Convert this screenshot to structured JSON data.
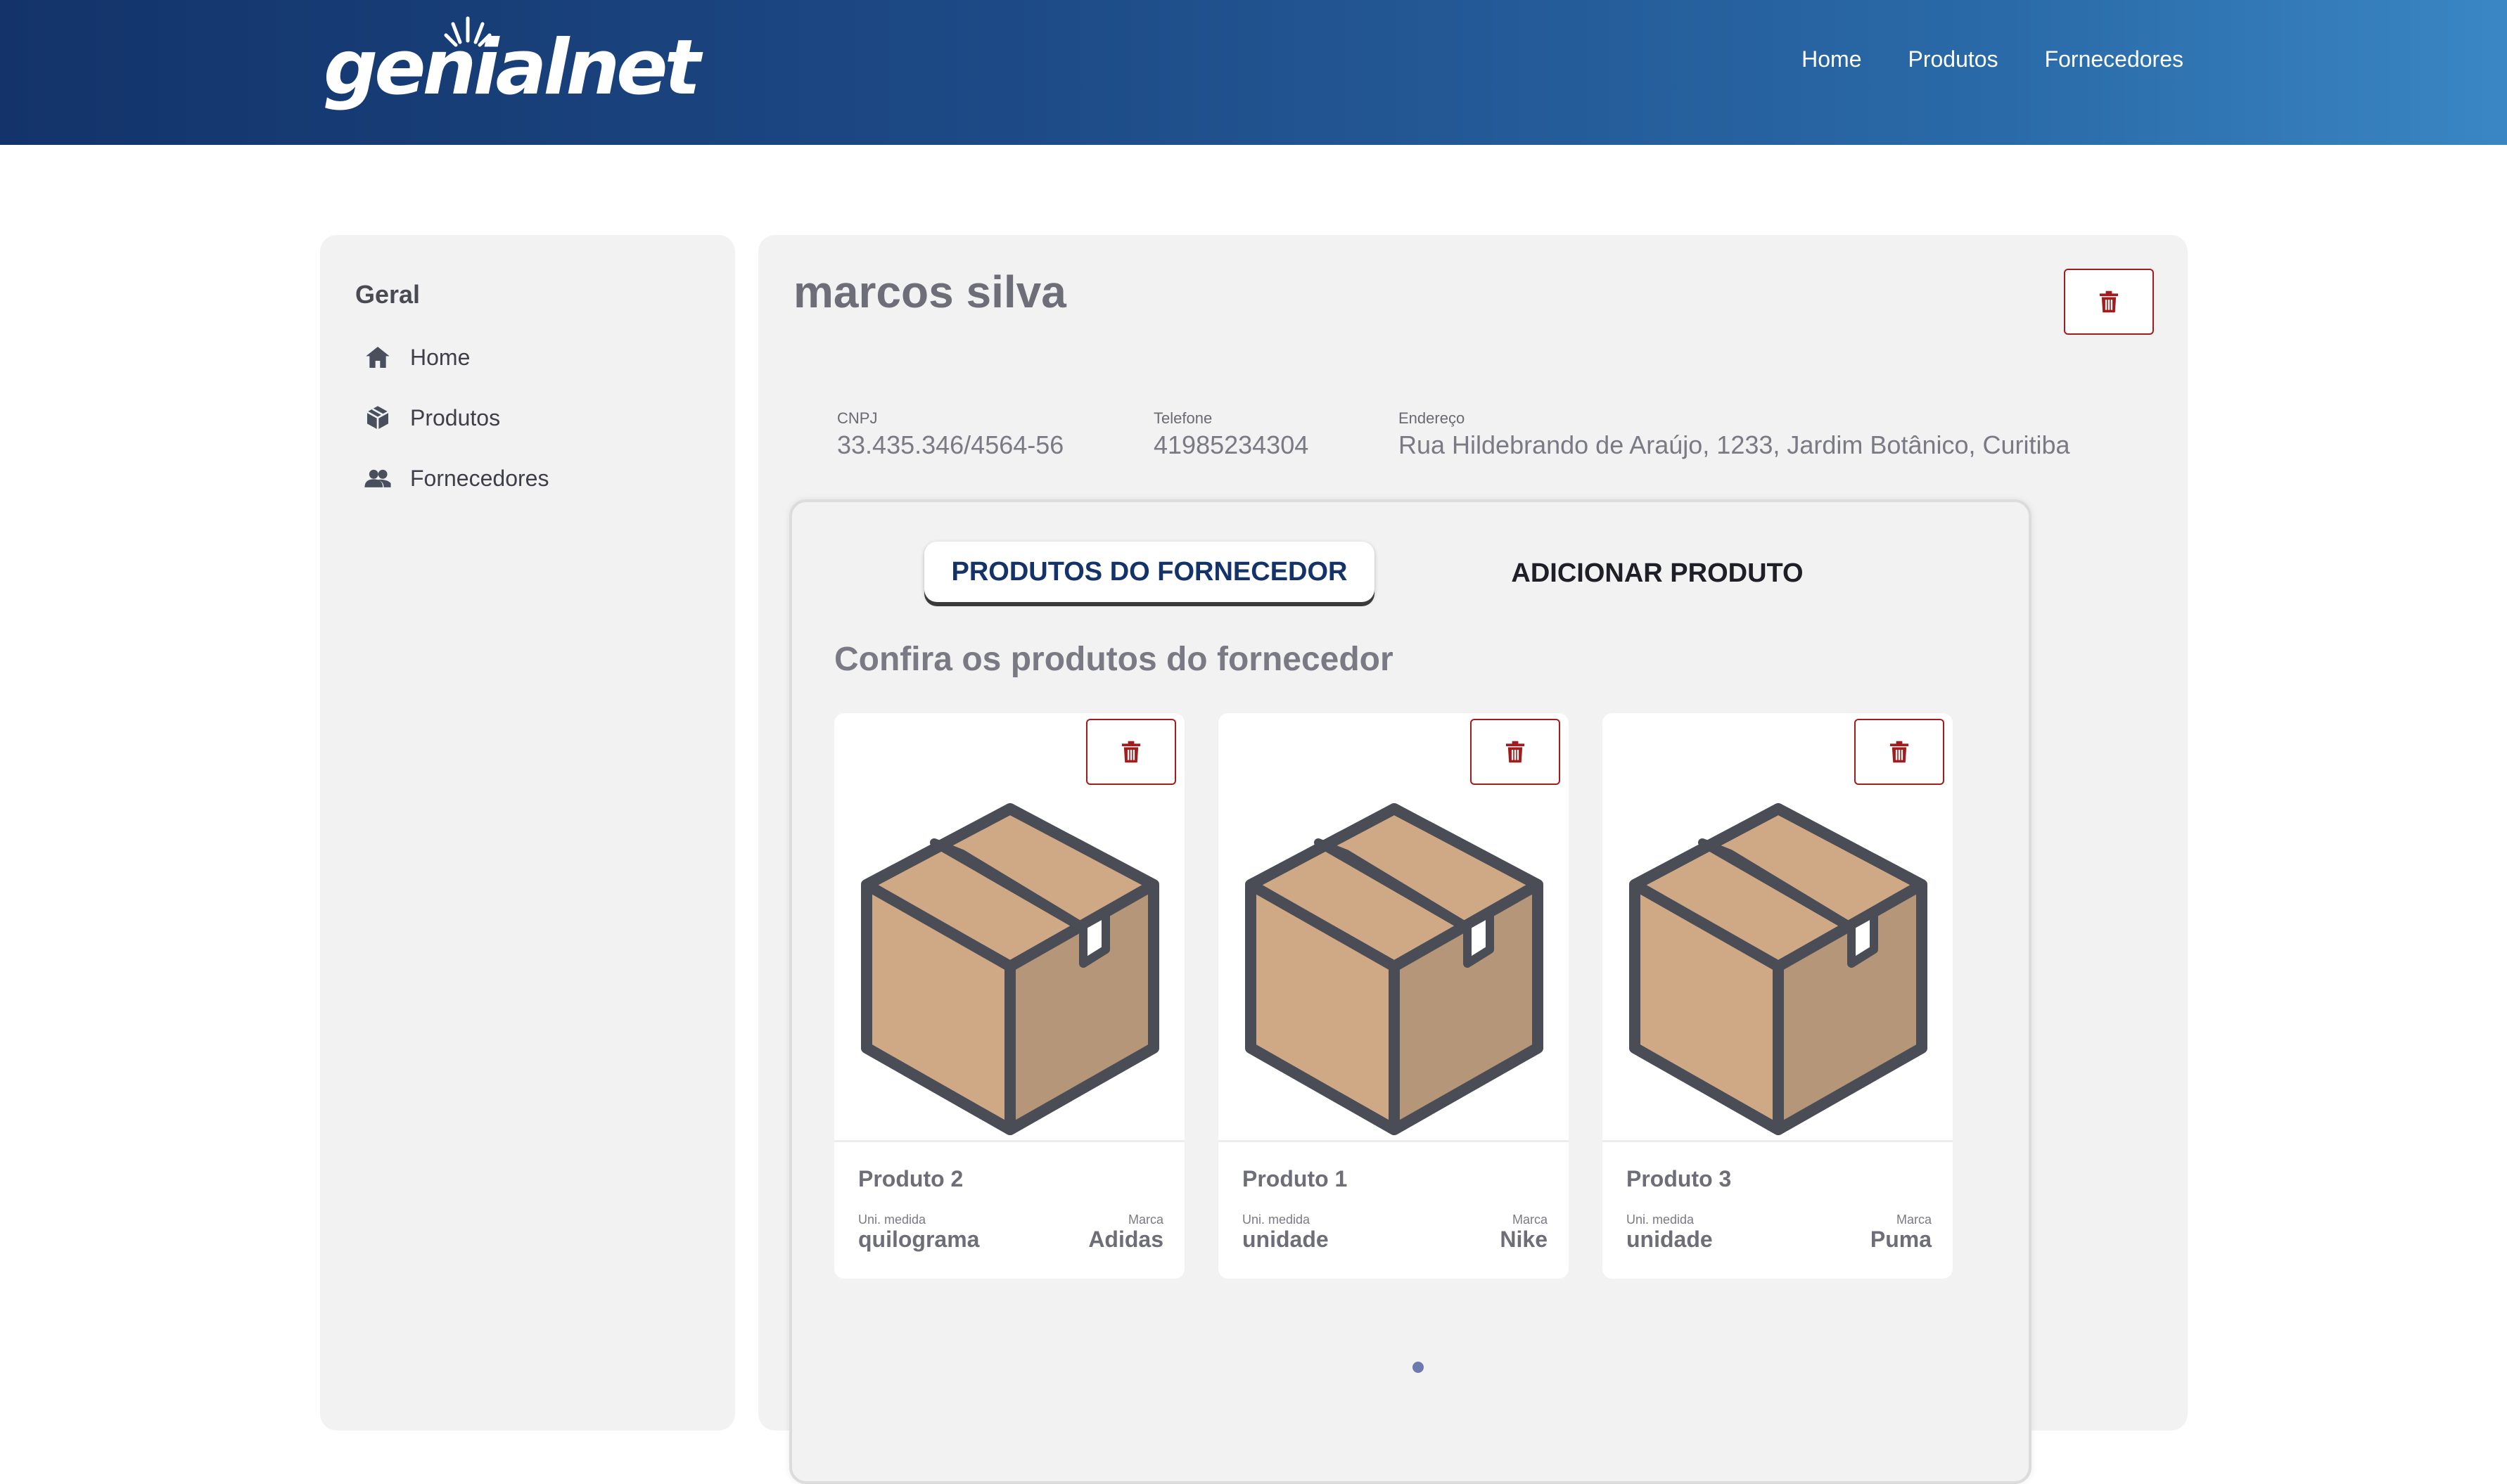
{
  "header": {
    "logo_text": "genialnet",
    "nav": [
      "Home",
      "Produtos",
      "Fornecedores"
    ]
  },
  "sidebar": {
    "title": "Geral",
    "items": [
      {
        "label": "Home",
        "icon": "home-icon"
      },
      {
        "label": "Produtos",
        "icon": "box-icon"
      },
      {
        "label": "Fornecedores",
        "icon": "users-icon"
      }
    ]
  },
  "supplier": {
    "name": "marcos silva",
    "cnpj_label": "CNPJ",
    "cnpj": "33.435.346/4564-56",
    "phone_label": "Telefone",
    "phone": "41985234304",
    "address_label": "Endereço",
    "address": "Rua Hildebrando de Araújo, 1233, Jardim Botânico, Curitiba"
  },
  "tabs": {
    "active": "PRODUTOS DO FORNECEDOR",
    "other": "ADICIONAR PRODUTO"
  },
  "products_section": {
    "title": "Confira os produtos do fornecedor",
    "unit_label": "Uni. medida",
    "brand_label": "Marca",
    "items": [
      {
        "name": "Produto 2",
        "unit": "quilograma",
        "brand": "Adidas"
      },
      {
        "name": "Produto 1",
        "unit": "unidade",
        "brand": "Nike"
      },
      {
        "name": "Produto 3",
        "unit": "unidade",
        "brand": "Puma"
      }
    ]
  },
  "colors": {
    "header_start": "#13336a",
    "header_end": "#3a86c4",
    "danger": "#a31c1c",
    "tab_active_text": "#13336a"
  }
}
